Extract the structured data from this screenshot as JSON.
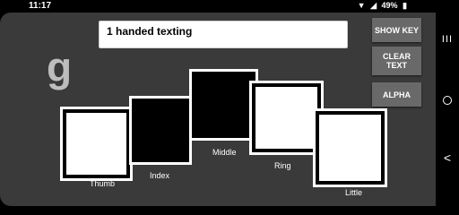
{
  "status": {
    "time": "11:17",
    "battery_percent": "49%",
    "icons": [
      "signal-icon",
      "wifi-icon",
      "battery-icon"
    ]
  },
  "text_field": {
    "value": "1 handed texting"
  },
  "buttons": {
    "show_key": "SHOW KEY",
    "clear_text_line1": "CLEAR",
    "clear_text_line2": "TEXT",
    "alpha": "ALPHA"
  },
  "current_letter": "g",
  "keys": {
    "thumb": "Thumb",
    "index": "Index",
    "middle": "Middle",
    "ring": "Ring",
    "little": "Little"
  },
  "nav": {
    "recents_glyph": "III",
    "back_glyph": "<"
  },
  "colors": {
    "app_background": "#3a3a3a",
    "button_background": "#696969",
    "key_white": "#ffffff",
    "key_black": "#000000"
  }
}
